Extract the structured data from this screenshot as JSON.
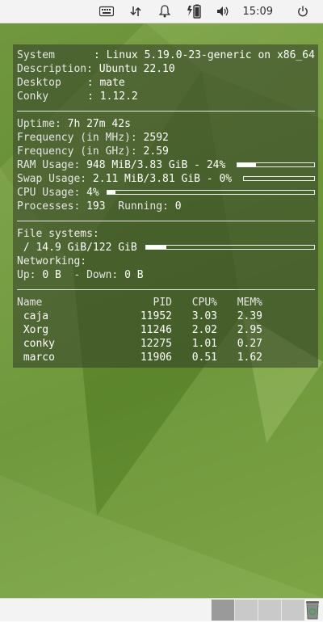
{
  "panel": {
    "clock": "15:09",
    "icons": [
      "keyboard-icon",
      "network-icon",
      "notification-bell-icon",
      "battery-icon",
      "volume-icon",
      "power-icon"
    ]
  },
  "conky": {
    "system_lbl": "System",
    "system_val": ": Linux 5.19.0-23-generic on x86_64",
    "desc_lbl": "Description:",
    "desc_val": "Ubuntu 22.10",
    "desktop_lbl": "Desktop",
    "desktop_val": ": mate",
    "conky_lbl": "Conky",
    "conky_val": ": 1.12.2",
    "uptime_lbl": "Uptime:",
    "uptime_val": "7h 27m 42s",
    "freq_mhz_lbl": "Frequency (in MHz):",
    "freq_mhz_val": "2592",
    "freq_ghz_lbl": "Frequency (in GHz):",
    "freq_ghz_val": "2.59",
    "ram_lbl": "RAM Usage:",
    "ram_val": "948 MiB/3.83 GiB - 24%",
    "ram_pct": 0.24,
    "swap_lbl": "Swap Usage:",
    "swap_val": "2.11 MiB/3.81 GiB - 0%",
    "swap_pct": 0.0,
    "cpu_lbl": "CPU Usage:",
    "cpu_val": "4%",
    "cpu_pct": 0.04,
    "proc_lbl": "Processes:",
    "proc_val": "193",
    "running_lbl": "Running:",
    "running_val": "0",
    "fs_lbl": "File systems:",
    "fs_val": " / 14.9 GiB/122 GiB",
    "fs_pct": 0.12,
    "net_lbl": "Networking:",
    "up_lbl": "Up:",
    "up_val": "0 B",
    "down_lbl": "- Down:",
    "down_val": "0 B",
    "table": {
      "headers": [
        "Name",
        "PID",
        "CPU%",
        "MEM%"
      ],
      "rows": [
        [
          " caja",
          "11952",
          "3.03",
          "2.39"
        ],
        [
          " Xorg",
          "11246",
          "2.02",
          "2.95"
        ],
        [
          " conky",
          "12275",
          "1.01",
          "0.27"
        ],
        [
          " marco",
          "11906",
          "0.51",
          "1.62"
        ]
      ]
    }
  },
  "colors": {
    "panel_bg": "#f3f3f3",
    "desktop_green": "#6c9238"
  }
}
